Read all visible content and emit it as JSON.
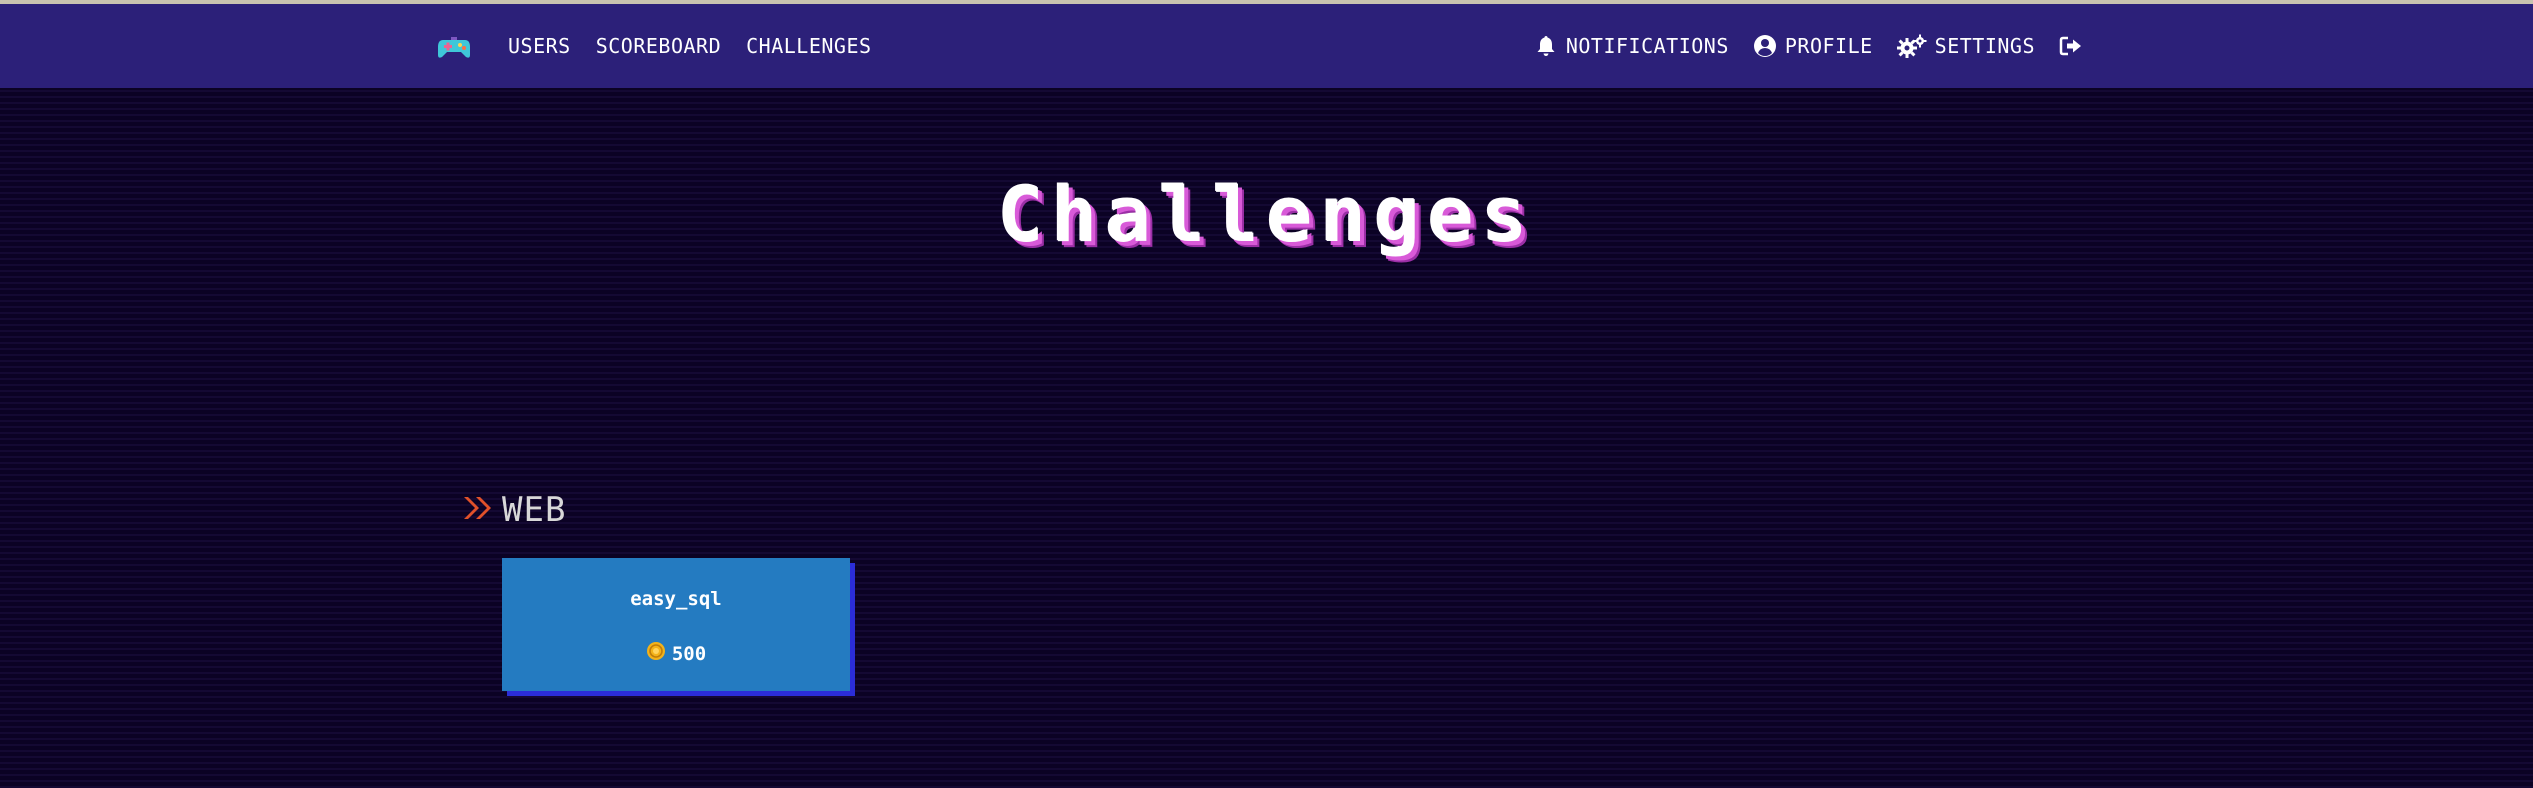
{
  "nav": {
    "left": [
      "USERS",
      "SCOREBOARD",
      "CHALLENGES"
    ],
    "notifications": "NOTIFICATIONS",
    "profile": "PROFILE",
    "settings": "SETTINGS"
  },
  "page": {
    "title": "Challenges"
  },
  "categories": [
    {
      "name": "WEB",
      "challenges": [
        {
          "name": "easy_sql",
          "points": "500"
        }
      ]
    }
  ],
  "colors": {
    "navbar": "#2c2079",
    "background": "#0b0224",
    "card": "#247bc1",
    "card_shadow": "#2b2dd8",
    "title_shadow": "#d85ad8",
    "category_arrow": "#e0512a",
    "coin": "#f2b21a"
  },
  "icons": [
    "gamepad-icon",
    "bell-icon",
    "user-circle-icon",
    "cogs-icon",
    "sign-out-icon",
    "double-chevron-right-icon",
    "coin-icon"
  ]
}
